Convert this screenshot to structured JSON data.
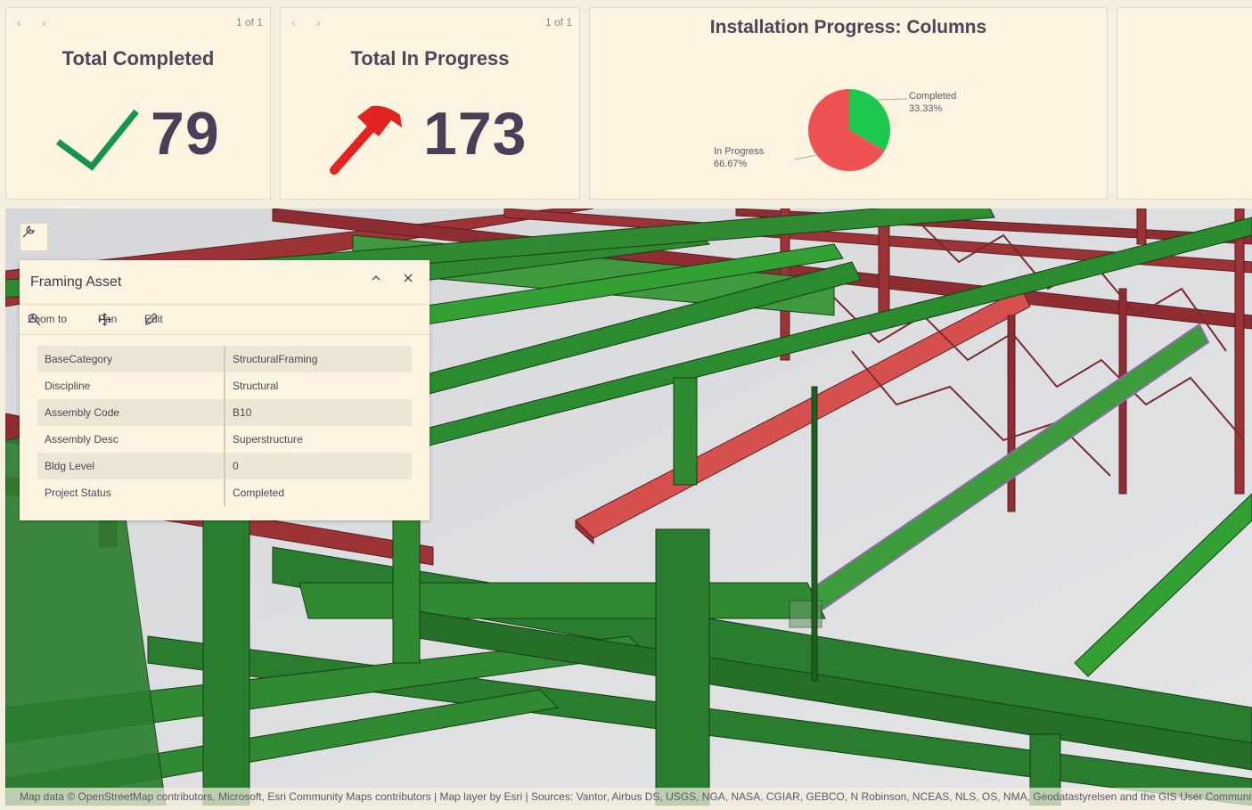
{
  "indicators": [
    {
      "pager": "1 of 1",
      "title": "Total Completed",
      "value": "79",
      "icon": "checkmark-icon",
      "color": "#16944e"
    },
    {
      "pager": "1 of 1",
      "title": "Total In Progress",
      "value": "173",
      "icon": "hammer-icon",
      "color": "#e1241f"
    }
  ],
  "chart_data": {
    "type": "pie",
    "title": "Installation Progress: Columns",
    "slices": [
      {
        "label": "Completed",
        "value": 33.33,
        "value_label": "33.33%",
        "color": "#1dc84e"
      },
      {
        "label": "In Progress",
        "value": 66.67,
        "value_label": "66.67%",
        "color": "#ee5252"
      }
    ]
  },
  "popup": {
    "title": "Framing Asset",
    "actions": {
      "zoom": "Zoom to",
      "pan": "Pan",
      "edit": "Edit"
    },
    "attributes": [
      {
        "key": "BaseCategory",
        "value": "StructuralFraming"
      },
      {
        "key": "Discipline",
        "value": "Structural"
      },
      {
        "key": "Assembly Code",
        "value": "B10"
      },
      {
        "key": "Assembly Desc",
        "value": "Superstructure"
      },
      {
        "key": "Bldg Level",
        "value": "0"
      },
      {
        "key": "Project Status",
        "value": "Completed"
      }
    ]
  },
  "attribution": "Map data © OpenStreetMap contributors, Microsoft, Esri Community Maps contributors | Map layer by Esri | Sources: Vantor, Airbus DS, USGS, NGA, NASA, CGIAR, GEBCO, N Robinson, NCEAS, NLS, OS, NMA, Geodatastyrelsen and the GIS User Community",
  "colors": {
    "completed": "#2e8a35",
    "in_progress": "#a8393c",
    "background": "#fcf4e1"
  }
}
